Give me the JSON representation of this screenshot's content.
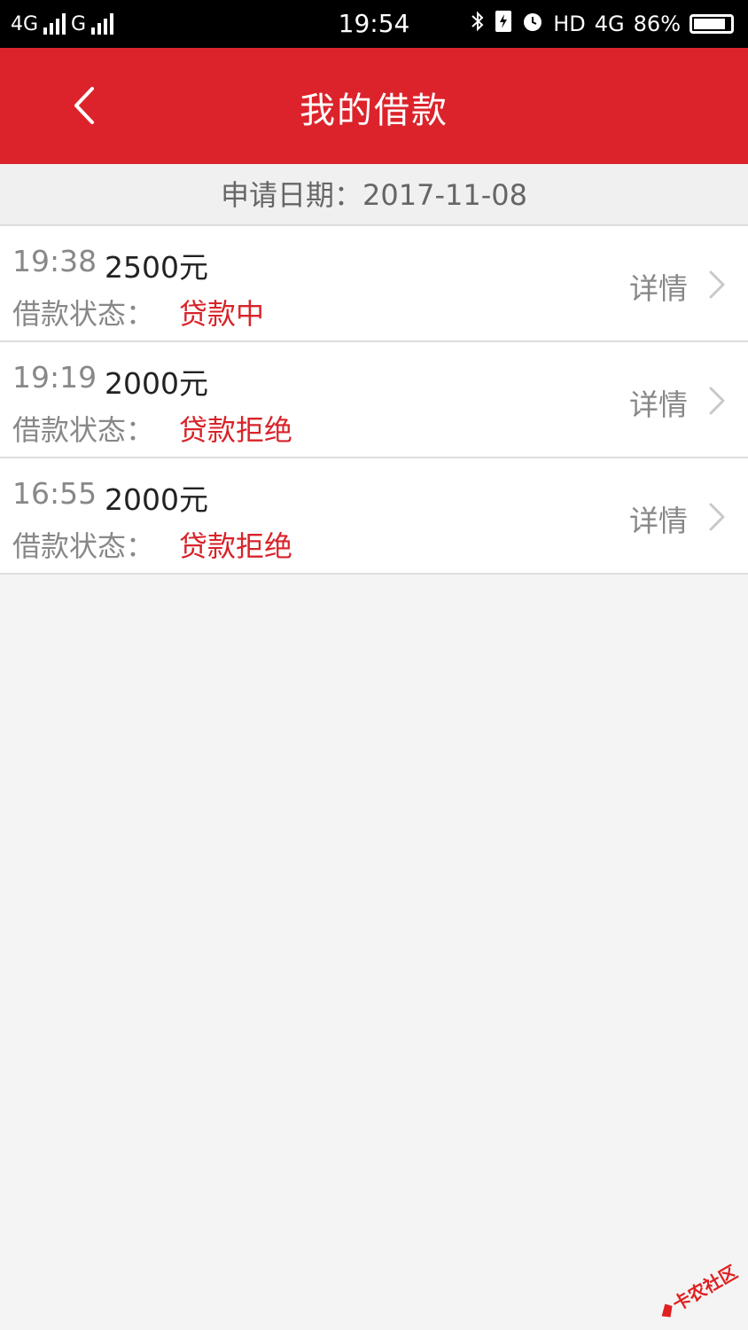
{
  "status_bar": {
    "network1": "4G",
    "network2": "G",
    "time": "19:54",
    "hd": "HD",
    "net4g": "4G",
    "battery": "86%"
  },
  "header": {
    "title": "我的借款"
  },
  "date_bar": {
    "label": "申请日期：2017-11-08"
  },
  "loans": [
    {
      "time": "19:38",
      "amount": "2500元",
      "status_label": "借款状态：",
      "status_value": "贷款中",
      "detail_label": "详情"
    },
    {
      "time": "19:19",
      "amount": "2000元",
      "status_label": "借款状态：",
      "status_value": "贷款拒绝",
      "detail_label": "详情"
    },
    {
      "time": "16:55",
      "amount": "2000元",
      "status_label": "借款状态：",
      "status_value": "贷款拒绝",
      "detail_label": "详情"
    }
  ],
  "watermark": {
    "text": "卡农社区"
  },
  "colors": {
    "brand_red": "#dc232b",
    "status_red": "#d8232a",
    "background": "#f4f4f4"
  },
  "icons": [
    "back-arrow-icon",
    "chevron-right-icon",
    "bluetooth-icon",
    "alarm-icon",
    "battery-icon",
    "signal-icon"
  ]
}
